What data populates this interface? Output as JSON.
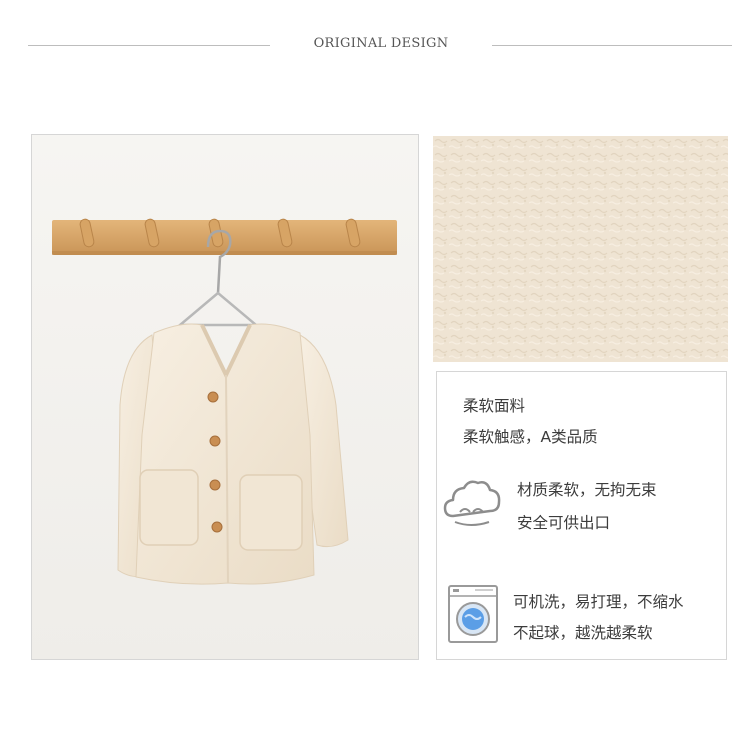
{
  "header": {
    "title": "ORIGINAL DESIGN"
  },
  "features": {
    "fabric_title": "柔软面料",
    "fabric_desc": "柔软触感，A类品质",
    "comfort_line1": "材质柔软，无拘无束",
    "comfort_line2": "安全可供出口",
    "wash_line1": "可机洗，易打理，不缩水",
    "wash_line2": "不起球，越洗越柔软"
  },
  "icons": {
    "comfort": "cloud-icon",
    "wash": "washing-machine-icon"
  },
  "colors": {
    "fabric": "#efe4d3",
    "wood": "#d9a86a",
    "jacket": "#f3e8d8",
    "buttons": "#c98e52"
  }
}
